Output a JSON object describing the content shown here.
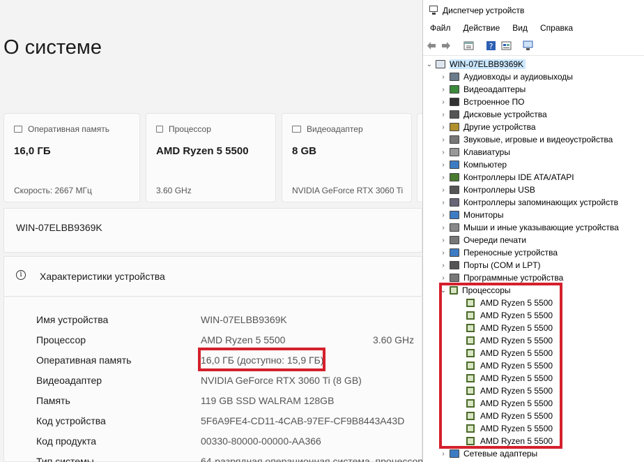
{
  "about": {
    "title": "О системе",
    "cards": [
      {
        "label": "Оперативная память",
        "value": "16,0 ГБ",
        "sub": "Скорость: 2667 МГц"
      },
      {
        "label": "Процессор",
        "value": "AMD Ryzen 5 5500",
        "sub": "3.60 GHz"
      },
      {
        "label": "Видеоадаптер",
        "value": "8 GB",
        "sub": "NVIDIA GeForce RTX 3060 Ti"
      }
    ],
    "device_name": "WIN-07ELBB9369K",
    "specs_title": "Характеристики устройства",
    "specs": [
      {
        "k": "Имя устройства",
        "v": "WIN-07ELBB9369K",
        "x": ""
      },
      {
        "k": "Процессор",
        "v": "AMD Ryzen 5 5500",
        "x": "3.60 GHz"
      },
      {
        "k": "Оперативная память",
        "v": "16,0 ГБ (доступно: 15,9 ГБ)",
        "x": ""
      },
      {
        "k": "Видеоадаптер",
        "v": "NVIDIA GeForce RTX 3060 Ti (8 GB)",
        "x": ""
      },
      {
        "k": "Память",
        "v": "119 GB SSD WALRAM  128GB",
        "x": ""
      },
      {
        "k": "Код устройства",
        "v": "5F6A9FE4-CD11-4CAB-97EF-CF9B8443A43D",
        "x": ""
      },
      {
        "k": "Код продукта",
        "v": "00330-80000-00000-AA366",
        "x": ""
      },
      {
        "k": "Тип системы",
        "v": "64-разрядная операционная система, процессор",
        "x": ""
      }
    ]
  },
  "device_manager": {
    "title": "Диспетчер устройств",
    "menu": [
      "Файл",
      "Действие",
      "Вид",
      "Справка"
    ],
    "root": "WIN-07ELBB9369K",
    "categories": [
      {
        "label": "Аудиовходы и аудиовыходы",
        "icon": "audio-icon"
      },
      {
        "label": "Видеоадаптеры",
        "icon": "display-adapter-icon"
      },
      {
        "label": "Встроенное ПО",
        "icon": "firmware-icon"
      },
      {
        "label": "Дисковые устройства",
        "icon": "disk-icon"
      },
      {
        "label": "Другие устройства",
        "icon": "unknown-device-icon"
      },
      {
        "label": "Звуковые, игровые и видеоустройства",
        "icon": "speaker-icon"
      },
      {
        "label": "Клавиатуры",
        "icon": "keyboard-icon"
      },
      {
        "label": "Компьютер",
        "icon": "computer-icon"
      },
      {
        "label": "Контроллеры IDE ATA/ATAPI",
        "icon": "ide-icon"
      },
      {
        "label": "Контроллеры USB",
        "icon": "usb-icon"
      },
      {
        "label": "Контроллеры запоминающих устройств",
        "icon": "storage-controller-icon"
      },
      {
        "label": "Мониторы",
        "icon": "monitor-icon"
      },
      {
        "label": "Мыши и иные указывающие устройства",
        "icon": "mouse-icon"
      },
      {
        "label": "Очереди печати",
        "icon": "printer-icon"
      },
      {
        "label": "Переносные устройства",
        "icon": "portable-device-icon"
      },
      {
        "label": "Порты (COM и LPT)",
        "icon": "port-icon"
      },
      {
        "label": "Программные устройства",
        "icon": "software-device-icon"
      },
      {
        "label": "Процессоры",
        "icon": "processor-icon"
      }
    ],
    "processors": [
      "AMD Ryzen 5 5500",
      "AMD Ryzen 5 5500",
      "AMD Ryzen 5 5500",
      "AMD Ryzen 5 5500",
      "AMD Ryzen 5 5500",
      "AMD Ryzen 5 5500",
      "AMD Ryzen 5 5500",
      "AMD Ryzen 5 5500",
      "AMD Ryzen 5 5500",
      "AMD Ryzen 5 5500",
      "AMD Ryzen 5 5500",
      "AMD Ryzen 5 5500"
    ],
    "after": [
      {
        "label": "Сетевые адаптеры",
        "icon": "network-adapter-icon"
      }
    ]
  },
  "colors": {
    "highlight": "#d4202c",
    "selection": "#cce8ff"
  }
}
